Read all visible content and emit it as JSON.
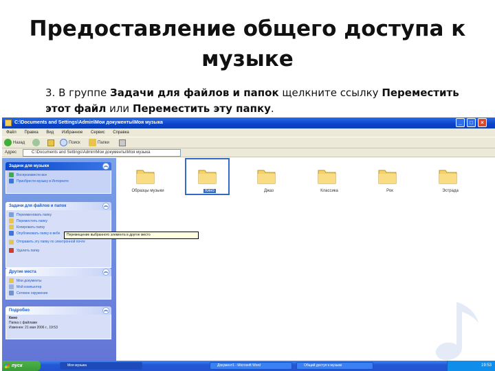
{
  "slide": {
    "title": "Предоставление общего доступа к музыке",
    "caption_prefix": "3. В группе ",
    "caption_bold1": "Задачи для файлов и папок",
    "caption_mid": " щелкните ссылку ",
    "caption_bold2": "Переместить этот файл",
    "caption_or": " или ",
    "caption_bold3": "Переместить эту папку",
    "caption_end": "."
  },
  "window": {
    "title": "C:\\Documents and Settings\\Admin\\Мои документы\\Моя музыка",
    "menu": [
      "Файл",
      "Правка",
      "Вид",
      "Избранное",
      "Сервис",
      "Справка"
    ],
    "toolbar": {
      "back": "Назад",
      "search": "Поиск",
      "folders": "Папки"
    },
    "address_label": "Адрес",
    "address_value": "C:\\Documents and Settings\\Admin\\Мои документы\\Моя музыка"
  },
  "task_pane": {
    "music_tasks": {
      "title": "Задачи для музыки",
      "items": [
        "Воспроизвести все",
        "Приобрести музыку в Интернете"
      ]
    },
    "file_tasks": {
      "title": "Задачи для файлов и папок",
      "items": [
        "Переименовать папку",
        "Переместить папку",
        "Копировать папку",
        "Опубликовать папку в вебе",
        "Отправить эту папку по электронной почте",
        "Удалить папку"
      ]
    },
    "other_places": {
      "title": "Другие места",
      "items": [
        "Мои документы",
        "Мой компьютер",
        "Сетевое окружение"
      ]
    },
    "details": {
      "title": "Подробно",
      "name": "Кино",
      "type": "Папка с файлами",
      "modified": "Изменен: 21 мая 2006 г., 19:53"
    }
  },
  "tooltip": "Перемещение выбранного элемента в другое место",
  "folders": [
    {
      "label": "Образцы музыки",
      "selected": false
    },
    {
      "label": "Кино",
      "selected": true
    },
    {
      "label": "Джаз",
      "selected": false
    },
    {
      "label": "Классика",
      "selected": false
    },
    {
      "label": "Рок",
      "selected": false
    },
    {
      "label": "Эстрада",
      "selected": false
    }
  ],
  "taskbar": {
    "start": "пуск",
    "tasks": [
      "Моя музыка",
      "Документ1 - Microsoft Word",
      "Общий доступ к музыке"
    ],
    "clock": "19:53"
  },
  "colors": {
    "xp_blue": "#0a44c9",
    "task_pane": "#6375d6",
    "folder_yellow": "#f4d16a",
    "selection": "#316ac5"
  }
}
